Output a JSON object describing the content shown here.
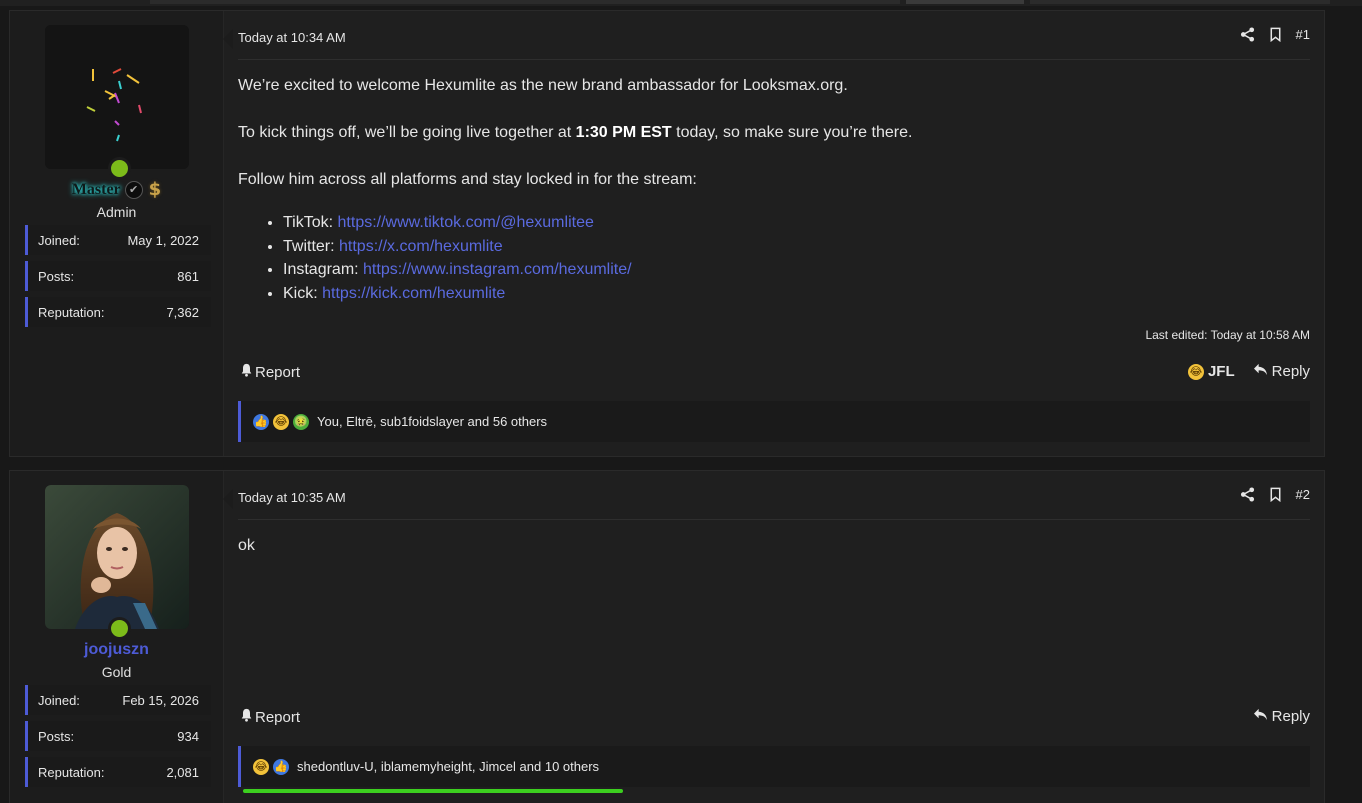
{
  "posts": [
    {
      "user": {
        "name": "Master",
        "title": "Admin",
        "stats": [
          {
            "label": "Joined:",
            "value": "May 1, 2022"
          },
          {
            "label": "Posts:",
            "value": "861"
          },
          {
            "label": "Reputation:",
            "value": "7,362"
          }
        ]
      },
      "date": "Today at 10:34 AM",
      "number": "#1",
      "body": {
        "p1": "We’re excited to welcome Hexumlite as the new brand ambassador for Looksmax.org.",
        "p2_before": "To kick things off, we’ll be going live together at ",
        "p2_bold": "1:30 PM EST",
        "p2_after": " today, so make sure you’re there.",
        "p3": "Follow him across all platforms and stay locked in for the stream:",
        "links": [
          {
            "label": "TikTok: ",
            "url": "https://www.tiktok.com/@hexumlitee"
          },
          {
            "label": "Twitter: ",
            "url": "https://x.com/hexumlite"
          },
          {
            "label": "Instagram: ",
            "url": "https://www.instagram.com/hexumlite/"
          },
          {
            "label": "Kick: ",
            "url": "https://kick.com/hexumlite"
          }
        ]
      },
      "last_edited": "Last edited: Today at 10:58 AM",
      "report_label": "Report",
      "jfl_label": "JFL",
      "reply_label": "Reply",
      "reactions_text": "You, Eltrē, sub1foidslayer and 56 others"
    },
    {
      "user": {
        "name": "joojuszn",
        "title": "Gold",
        "stats": [
          {
            "label": "Joined:",
            "value": "Feb 15, 2026"
          },
          {
            "label": "Posts:",
            "value": "934"
          },
          {
            "label": "Reputation:",
            "value": "2,081"
          }
        ]
      },
      "date": "Today at 10:35 AM",
      "number": "#2",
      "body_text": "ok",
      "report_label": "Report",
      "reply_label": "Reply",
      "reactions_text": "shedontluv-U, iblamemyheight, Jimcel and 10 others"
    }
  ],
  "colors": {
    "accent": "#4d5bd6",
    "link": "#5a6adf",
    "online": "#7cbb1a",
    "progress": "#3ccf1f"
  }
}
